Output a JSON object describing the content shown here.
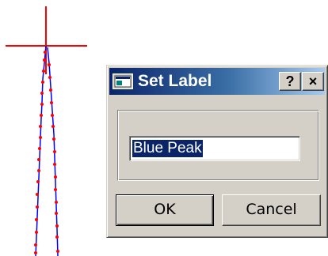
{
  "plot": {
    "crosshair_color": "#ff0000",
    "line_color": "#0000ff",
    "marker_color": "#ff0000"
  },
  "dialog": {
    "title": "Set Label",
    "icon": "window-app-icon",
    "help_label": "?",
    "close_label": "×",
    "input_value": "Blue Peak",
    "ok_label": "OK",
    "cancel_label": "Cancel",
    "titlebar_color": "#0a246a",
    "face_color": "#d4d0c8"
  }
}
